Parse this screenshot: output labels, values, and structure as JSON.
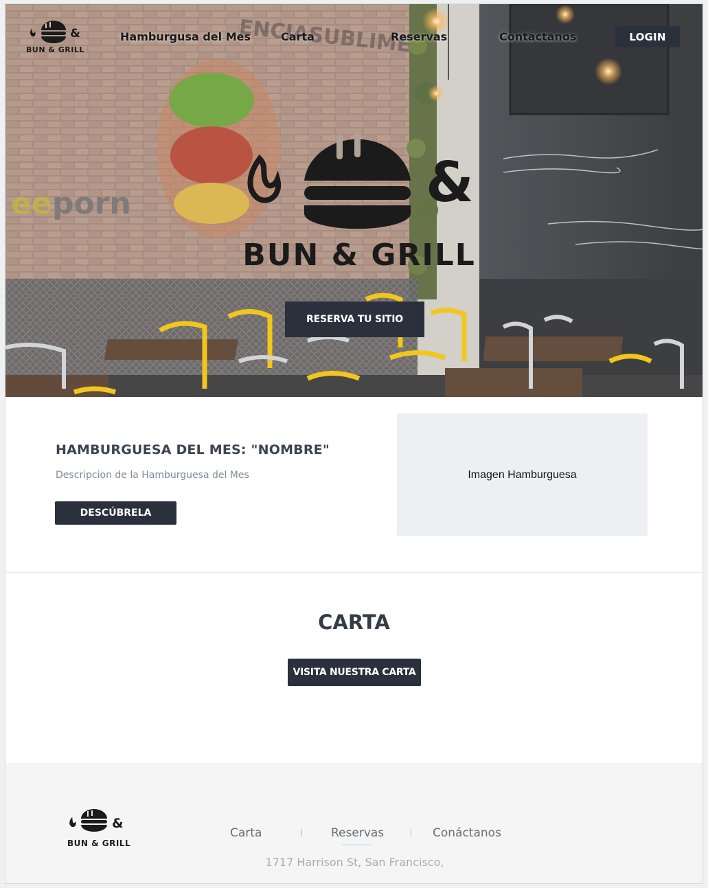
{
  "nav": {
    "logo_text": "BUN & GRILL",
    "links": [
      "Hamburgusa del Mes",
      "Carta",
      "Reservas",
      "Contáctanos"
    ],
    "login_label": "LOGIN"
  },
  "hero": {
    "logo_text": "BUN & GRILL",
    "reserve_label": "RESERVA TU SITIO"
  },
  "feature": {
    "title": "HAMBURGUESA DEL MES: \"NOMBRE\"",
    "description": "Descripcion de la Hamburguesa del Mes",
    "button_label": "DESCÚBRELA",
    "image_placeholder": "Imagen Hamburguesa"
  },
  "carta": {
    "title": "CARTA",
    "button_label": "VISITA NUESTRA CARTA"
  },
  "footer": {
    "logo_text": "BUN & GRILL",
    "links": [
      "Carta",
      "Reservas",
      "Conáctanos"
    ],
    "address": "1717 Harrison St, San Francisco,"
  },
  "colors": {
    "dark_button": "#2a303c",
    "heading": "#343c48",
    "muted_text": "#7d8a99",
    "placeholder_bg": "#edf0f3",
    "footer_bg": "#f5f5f5"
  }
}
